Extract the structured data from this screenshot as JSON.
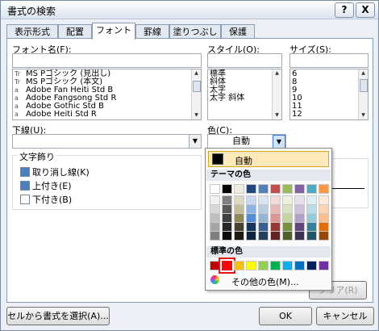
{
  "window": {
    "title": "書式の検索",
    "help": "?",
    "close": "X"
  },
  "tabs": [
    {
      "label": "表示形式"
    },
    {
      "label": "配置"
    },
    {
      "label": "フォント"
    },
    {
      "label": "罫線"
    },
    {
      "label": "塗りつぶし"
    },
    {
      "label": "保護"
    }
  ],
  "font": {
    "label": "フォント名(F):",
    "value": "",
    "items": [
      "MS Pゴシック (見出し)",
      "MS Pゴシック (本文)",
      "Adobe Fan Heiti Std B",
      "Adobe Fangsong Std R",
      "Adobe Gothic Std B",
      "Adobe Heiti Std R"
    ],
    "icons": [
      "Tr",
      "Tr",
      "a",
      "a",
      "a",
      "a"
    ]
  },
  "style": {
    "label": "スタイル(O):",
    "value": "",
    "items": [
      "標準",
      "斜体",
      "太字",
      "太字 斜体"
    ]
  },
  "size": {
    "label": "サイズ(S):",
    "value": "",
    "items": [
      "6",
      "8",
      "9",
      "10",
      "11",
      "12"
    ]
  },
  "underline": {
    "label": "下線(U):",
    "value": ""
  },
  "color": {
    "label": "色(C):",
    "value": "自動"
  },
  "effects": {
    "label": "文字飾り",
    "items": [
      {
        "label": "取り消し線(K)",
        "checked": true
      },
      {
        "label": "上付き(E)",
        "checked": true
      },
      {
        "label": "下付き(B)",
        "checked": false
      }
    ]
  },
  "buttons": {
    "select_from_cell": "セルから書式を選択(A)...",
    "clear": "クリア(R)",
    "ok": "OK",
    "cancel": "キャンセル"
  },
  "color_popup": {
    "auto_label": "自動",
    "theme_label": "テーマの色",
    "standard_label": "標準の色",
    "more_colors": "その他の色(M)...",
    "theme_colors": [
      [
        "#ffffff",
        "#000000",
        "#eeece1",
        "#1f497d",
        "#4f81bd",
        "#c0504d",
        "#9bbb59",
        "#8064a2",
        "#4bacc6",
        "#f79646"
      ],
      [
        "#f2f2f2",
        "#7f7f7f",
        "#ddd9c3",
        "#c6d9f0",
        "#dbe5f1",
        "#f2dcdb",
        "#ebf1dd",
        "#e5e0ec",
        "#dbeef3",
        "#fdeada"
      ],
      [
        "#d8d8d8",
        "#595959",
        "#c4bd97",
        "#8db3e2",
        "#b8cce4",
        "#e5b9b7",
        "#d7e3bc",
        "#ccc1d9",
        "#b7dde8",
        "#fbd5b5"
      ],
      [
        "#bfbfbf",
        "#3f3f3f",
        "#938953",
        "#548dd4",
        "#95b3d7",
        "#d99694",
        "#c3d69b",
        "#b2a2c7",
        "#92cddc",
        "#fac08f"
      ],
      [
        "#a5a5a5",
        "#262626",
        "#494429",
        "#17365d",
        "#366092",
        "#953734",
        "#76923c",
        "#5f497a",
        "#31859b",
        "#e36c09"
      ],
      [
        "#7f7f7f",
        "#0c0c0c",
        "#1d1b10",
        "#0f243e",
        "#244061",
        "#632423",
        "#4f6128",
        "#3f3151",
        "#205867",
        "#974806"
      ]
    ],
    "standard_colors": [
      "#c00000",
      "#ff0000",
      "#ffc000",
      "#ffff00",
      "#92d050",
      "#00b050",
      "#00b0f0",
      "#0070c0",
      "#002060",
      "#7030a0"
    ],
    "selected_standard": 1
  }
}
